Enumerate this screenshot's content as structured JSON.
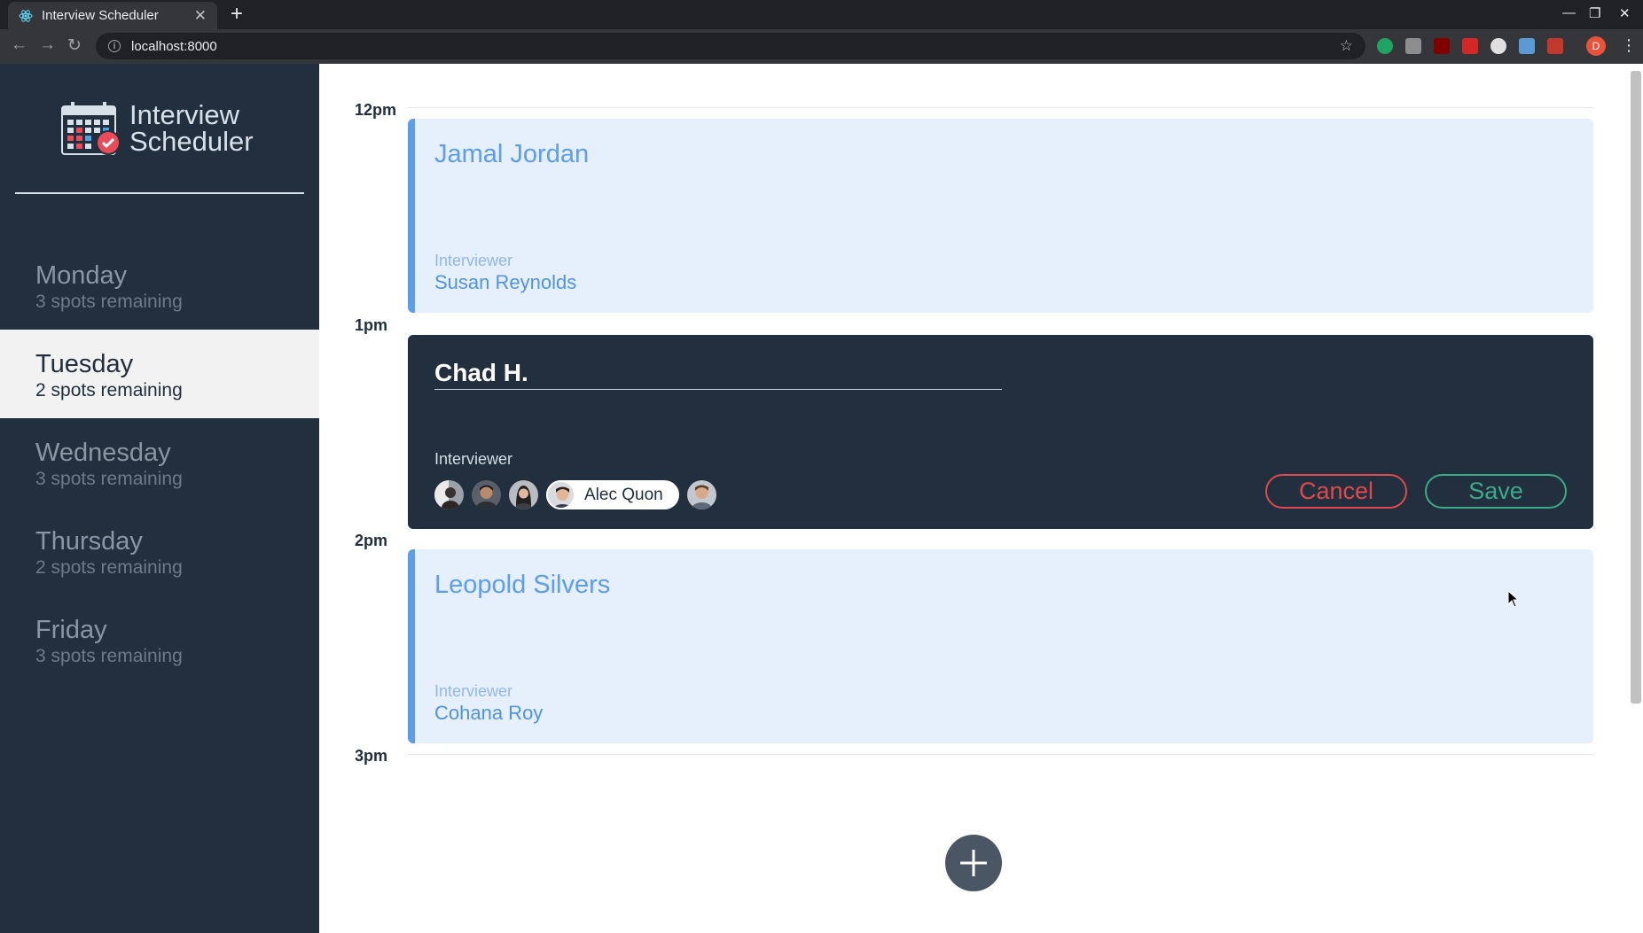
{
  "browser": {
    "tab_title": "Interview Scheduler",
    "tab_close": "✕",
    "new_tab": "+",
    "url": "localhost:8000",
    "profile_initial": "D",
    "window_controls": [
      "—",
      "❐",
      "✕"
    ]
  },
  "app": {
    "logo_line1": "Interview",
    "logo_line2": "Scheduler"
  },
  "sidebar": {
    "days": [
      {
        "name": "Monday",
        "spots": "3 spots remaining"
      },
      {
        "name": "Tuesday",
        "spots": "2 spots remaining"
      },
      {
        "name": "Wednesday",
        "spots": "3 spots remaining"
      },
      {
        "name": "Thursday",
        "spots": "2 spots remaining"
      },
      {
        "name": "Friday",
        "spots": "3 spots remaining"
      }
    ],
    "selected_day": "Tuesday"
  },
  "schedule": {
    "times": [
      "12pm",
      "1pm",
      "2pm",
      "3pm"
    ],
    "appointments": [
      {
        "student": "Jamal Jordan",
        "interviewer_label": "Interviewer",
        "interviewer": "Susan Reynolds"
      },
      {
        "student": "Leopold Silvers",
        "interviewer_label": "Interviewer",
        "interviewer": "Cohana Roy"
      }
    ],
    "form": {
      "student_value": "Chad H.",
      "interviewer_label": "Interviewer",
      "selected_interviewer": "Alec Quon",
      "cancel_label": "Cancel",
      "save_label": "Save"
    }
  },
  "colors": {
    "sidebar_bg": "#222f3e",
    "appointment_bg": "#e6effc",
    "accent_blue": "#5c9ded",
    "cancel_red": "#e0494d",
    "save_green": "#3ea98b"
  }
}
